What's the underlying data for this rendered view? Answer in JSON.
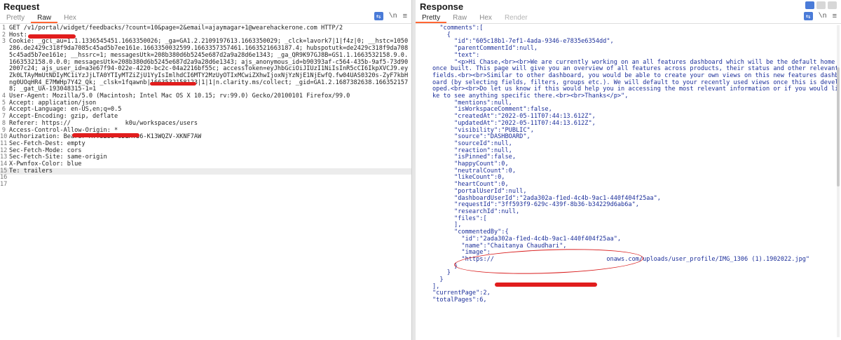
{
  "request": {
    "title": "Request",
    "tabs": [
      "Pretty",
      "Raw",
      "Hex"
    ],
    "active_tab": "Raw",
    "tools": {
      "newline": "\\n",
      "menu": "≡"
    },
    "lines": [
      "GET /v1/portal/widget/feedbacks/?count=10&page=2&email=ajaymagar+1@wearehackerone.com HTTP/2",
      "Host: ",
      "Cookie: _gcl_au=1.1.1336545451.1663350026; _ga=GA1.2.2109197613.1663350029; _clck=lavork7|1|f4z|0; __hstc=1050286.de2429c318f9da7085c45ad5b7ee161e.1663350032599.1663357357461.1663521663187.4; hubspotutk=de2429c318f9da7085c45ad5b7ee161e; __hssrc=1; messagesUtk=208b380d6b5245e687d2a9a28d6e1343; _ga_QR9K97GJ8B=GS1.1.1663532158.9.0.1663532158.0.0.0; messagesUtk=208b380d6b5245e687d2a9a28d6e1343; ajs_anonymous_id=b90393af-c564-435b-9af5-73d902007c24; ajs_user_id=a3e67f94-022e-4220-bc2c-04a2216bf55c; accessToken=eyJhbGciOiJIUzI1NiIsInR5cCI6IkpXVCJ9.ey                 Zk0LTAyMmUtNDIyMC1iYzJjLTA0YTIyMTZiZjU1YyIsImlhdCI6MTY2MzUyOTIxMCwiZXhwIjoxNjYzNjE1NjEwfQ.fw04UAS0320s-ZyF7kbHng0UOqHR4_E7MWHp7Y42_Qk; _clsk=1fqawnb|1663532158123|1|1|n.clarity.ms/collect; _gid=GA1.2.1687382638.1663521578; _gat_UA-193048315-1=1",
      "User-Agent: Mozilla/5.0 (Macintosh; Intel Mac OS X 10.15; rv:99.0) Gecko/20100101 Firefox/99.0",
      "Accept: application/json",
      "Accept-Language: en-US,en;q=0.5",
      "Accept-Encoding: gzip, deflate",
      "Referer: https://               k0u/workspaces/users",
      "Access-Control-Allow-Origin: *",
      "Authorization: Bearer MTYS238-8DEMT36-K13WQZV-XKNF7AW",
      "Sec-Fetch-Dest: empty",
      "Sec-Fetch-Mode: cors",
      "Sec-Fetch-Site: same-origin",
      "X-Pwnfox-Color: blue",
      "Te: trailers",
      "",
      ""
    ],
    "line_numbers": [
      "1",
      "2",
      "3",
      "",
      "",
      "",
      "",
      "",
      "",
      "4",
      "5",
      "6",
      "7",
      "8",
      "9",
      "10",
      "11",
      "12",
      "13",
      "14",
      "15",
      "16",
      "17"
    ]
  },
  "response": {
    "title": "Response",
    "tabs": [
      "Pretty",
      "Raw",
      "Hex",
      "Render"
    ],
    "active_tab": "Pretty",
    "tools": {
      "newline": "\\n",
      "menu": "≡"
    },
    "lines": [
      "  \"comments\":[",
      "    {",
      "      \"id\":\"605c18b1-7ef1-4ada-9346-e7835e6354dd\",",
      "      \"parentCommentId\":null,",
      "      \"text\":",
      "      \"<p>Hi Chase,<br><br>We are currently working on an all features dashboard which will be the default home once built. This page will give you an overview of all features across products, their status and other relevant fields.<br><br>Similar to other dashboard, you would be able to create your own views on this new features dashboard (by selecting fields, filters, groups etc.). We will default to your recently used views once this is developed.<br><br>Do let us know if this would help you in accessing the most relevant information or if you would like to see anything specific there.<br><br>Thanks</p>\",",
      "      \"mentions\":null,",
      "      \"isWorkspaceComment\":false,",
      "      \"createdAt\":\"2022-05-11T07:44:13.612Z\",",
      "      \"updatedAt\":\"2022-05-11T07:44:13.612Z\",",
      "      \"visibility\":\"PUBLIC\",",
      "      \"source\":\"DASHBOARD\",",
      "      \"sourceId\":null,",
      "      \"reaction\":null,",
      "      \"isPinned\":false,",
      "      \"happyCount\":0,",
      "      \"neutralCount\":0,",
      "      \"likeCount\":0,",
      "      \"heartCount\":0,",
      "      \"portalUserId\":null,",
      "      \"dashboardUserId\":\"2ada302a-f1ed-4c4b-9ac1-440f404f25aa\",",
      "      \"requestId\":\"3ff593f9-629c-439f-8b36-b34229d6ab6a\",",
      "      \"researchId\":null,",
      "      \"files\":[",
      "      ],",
      "      \"commentedBy\":{",
      "        \"id\":\"2ada302a-f1ed-4c4b-9ac1-440f404f25aa\",",
      "        \"name\":\"Chaitanya Chaudhari\",",
      "        \"image\":",
      "        \"https://                               onaws.com/uploads/user_profile/IMG_1306 (1).1902022.jpg\"",
      "      }",
      "    }",
      "  }",
      "],",
      "\"currentPage\":2,",
      "\"totalPages\":6,"
    ]
  }
}
